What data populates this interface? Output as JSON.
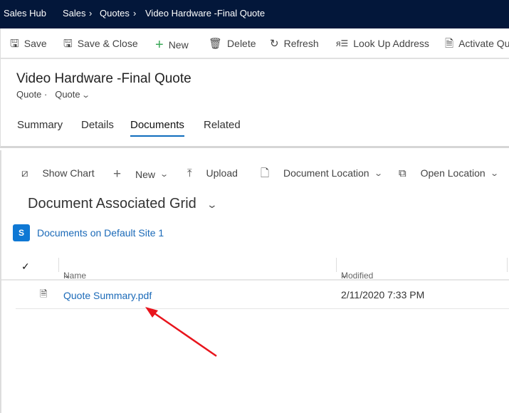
{
  "topbar": {
    "app": "Sales Hub",
    "crumbs": [
      "Sales",
      "Quotes",
      "Video Hardware -Final Quote"
    ]
  },
  "commands": [
    {
      "label": "Save",
      "icon": "save-icon"
    },
    {
      "label": "Save & Close",
      "icon": "save-close-icon"
    },
    {
      "label": "New",
      "icon": "plus-icon"
    },
    {
      "label": "Delete",
      "icon": "trash-icon"
    },
    {
      "label": "Refresh",
      "icon": "refresh-icon"
    },
    {
      "label": "Look Up Address",
      "icon": "lookup-address-icon"
    },
    {
      "label": "Activate Qu",
      "icon": "activate-quote-icon"
    }
  ],
  "record": {
    "title": "Video Hardware -Final Quote",
    "entity": "Quote ·",
    "form": "Quote"
  },
  "tabs": [
    "Summary",
    "Details",
    "Documents",
    "Related"
  ],
  "subgrid": {
    "toolbar": [
      "Show Chart",
      "New",
      "Upload",
      "Document Location",
      "Open Location"
    ],
    "title": "Document Associated Grid",
    "location": "Documents on Default Site 1",
    "columns": [
      "Name",
      "Modified"
    ],
    "rows": [
      {
        "name": "Quote Summary.pdf",
        "modified": "2/11/2020 7:33 PM"
      }
    ]
  },
  "colors": {
    "topbar": "#03173a",
    "accent": "#0f6cbd",
    "annotation": "#e8141c"
  }
}
